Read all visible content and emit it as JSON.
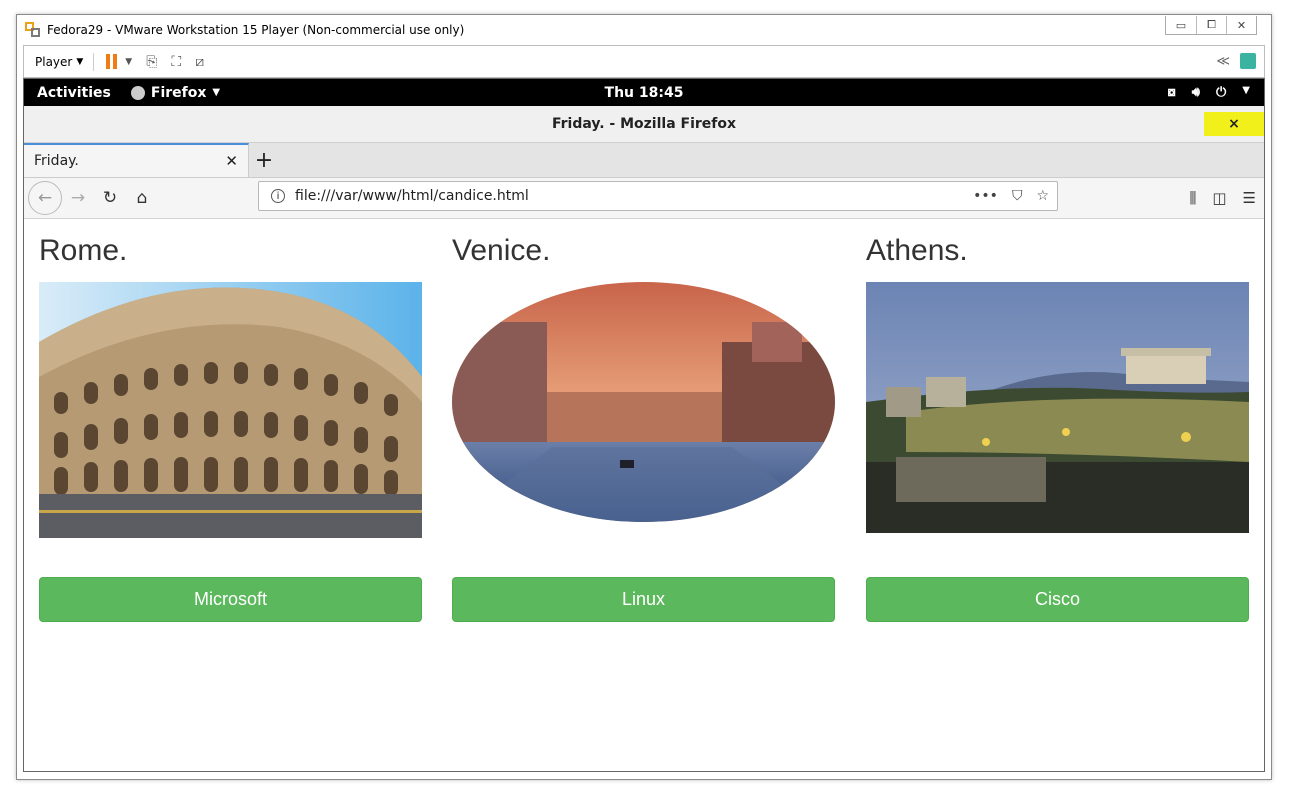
{
  "vmware": {
    "window_title": "Fedora29 - VMware Workstation 15 Player (Non-commercial use only)",
    "player_label": "Player",
    "window_controls": [
      "▭",
      "⧠",
      "✕"
    ]
  },
  "gnome": {
    "activities": "Activities",
    "app_menu": "Firefox",
    "clock": "Thu 18:45"
  },
  "firefox": {
    "window_title": "Friday. - Mozilla Firefox",
    "close_label": "×",
    "tab_title": "Friday.",
    "url": "file:///var/www/html/candice.html"
  },
  "page": {
    "cards": [
      {
        "heading": "Rome.",
        "button": "Microsoft",
        "image": "colosseum"
      },
      {
        "heading": "Venice.",
        "button": "Linux",
        "image": "venice-canal-oval"
      },
      {
        "heading": "Athens.",
        "button": "Cisco",
        "image": "acropolis"
      }
    ]
  },
  "colors": {
    "button_green": "#5cb85c",
    "highlight_yellow": "#f1f01a",
    "vmware_pause": "#f07c16"
  }
}
